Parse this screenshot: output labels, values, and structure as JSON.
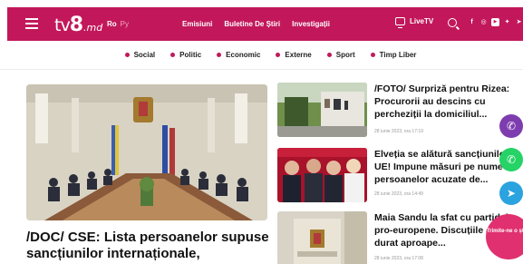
{
  "header": {
    "logo": {
      "tv": "tv",
      "eight": "8",
      "md": ".md"
    },
    "lang_active": "Ro",
    "lang_inactive": "Ру",
    "nav": [
      "Emisiuni",
      "Buletine De Știri",
      "Investigații"
    ],
    "livetv_label": "LiveTV",
    "social_icons": [
      "facebook-icon",
      "instagram-icon",
      "youtube-icon",
      "twitter-icon",
      "telegram-icon"
    ]
  },
  "categories": [
    "Social",
    "Politic",
    "Economic",
    "Externe",
    "Sport",
    "Timp Liber"
  ],
  "hero": {
    "title": "/DOC/ CSE: Lista persoanelor supuse sancțiunilor internaționale,"
  },
  "side_news": [
    {
      "title": "/FOTO/ Surpriză pentru Rizea: Procurorii au descins cu percheziții la domiciliul...",
      "date": "28 iunie 2023, ora 17:19"
    },
    {
      "title": "Elveția se alătură sancțiunilor UE! Impune măsuri pe nume persoanelor acuzate de...",
      "date": "28 iunie 2023, ora 14:49"
    },
    {
      "title": "Maia Sandu la sfat cu partidele pro-europene. Discuțiile au durat aproape...",
      "date": "28 iunie 2023, ora 17:08"
    }
  ],
  "share": {
    "send_news": "Trimite-ne o știre"
  },
  "colors": {
    "brand": "#c2185b",
    "viber": "#7d3daf",
    "whatsapp": "#25d366",
    "telegram": "#2aa3df"
  }
}
